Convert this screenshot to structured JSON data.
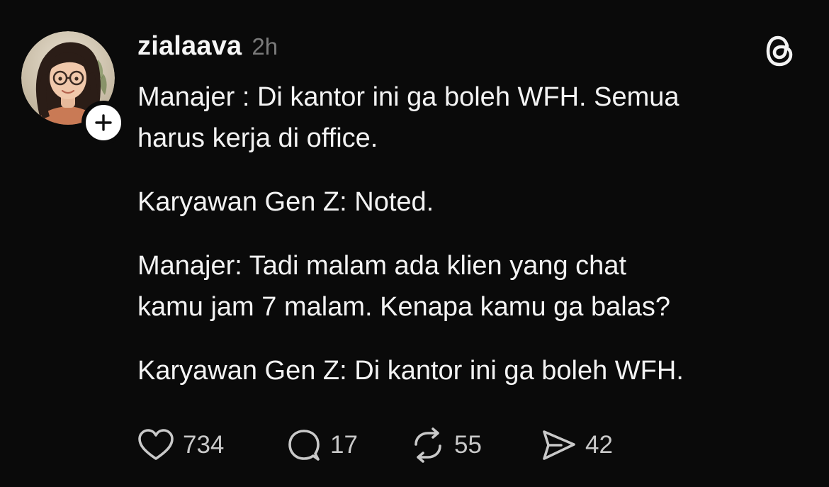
{
  "post": {
    "username": "zialaava",
    "time": "2h",
    "paragraphs": [
      "Manajer : Di kantor ini ga boleh WFH. Semua\nharus kerja di office.",
      "Karyawan Gen Z: Noted.",
      "Manajer: Tadi malam ada klien yang chat\nkamu jam 7 malam. Kenapa kamu ga balas?",
      "Karyawan Gen Z: Di kantor ini ga boleh WFH."
    ],
    "likes": "734",
    "replies": "17",
    "reposts": "55",
    "shares": "42"
  },
  "icons": {
    "follow": "plus-icon",
    "brand": "threads-logo-icon",
    "like": "heart-icon",
    "reply": "speech-bubble-icon",
    "repost": "repost-arrows-icon",
    "share": "send-icon"
  },
  "colors": {
    "background": "#0a0a0a",
    "text": "#f3f3f3",
    "muted": "#7a7a7a"
  }
}
